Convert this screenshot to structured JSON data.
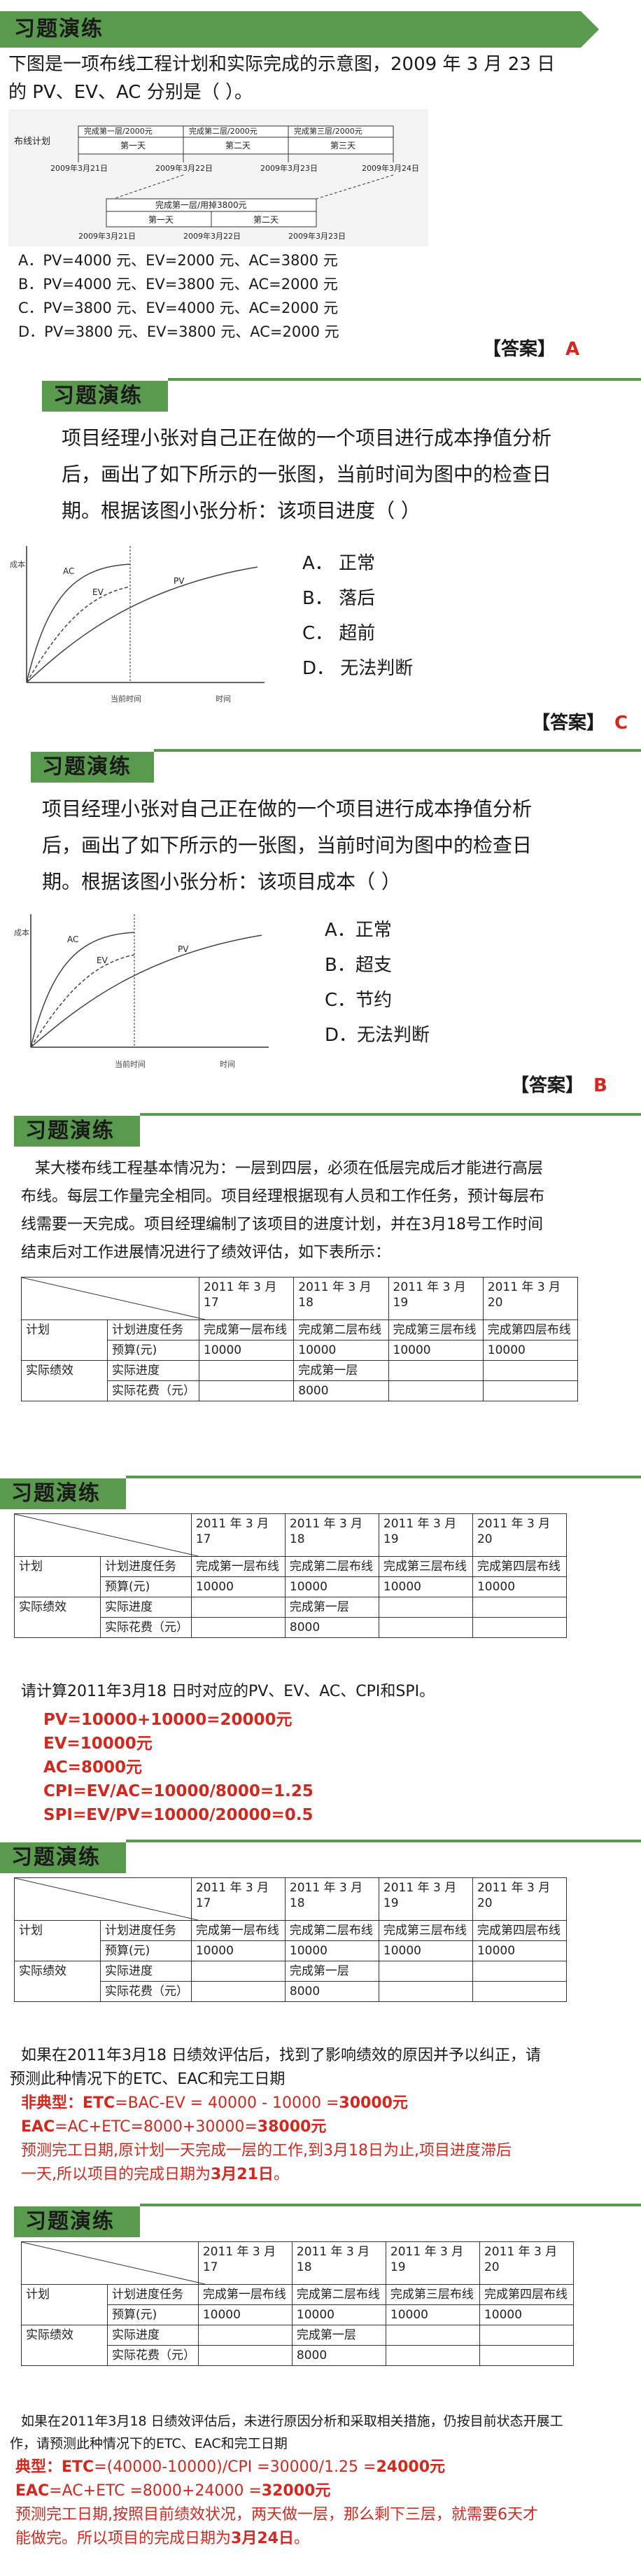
{
  "slide1": {
    "title": "习题演练",
    "question_line1": "下图是一项布线工程计划和实际完成的示意图，2009 年 3 月 23 日",
    "question_line2": "的 PV、EV、AC 分别是（    ）。",
    "diagram": {
      "row_label": "布线计划",
      "plan_cells": [
        "完成第一层/2000元",
        "完成第二层/2000元",
        "完成第三层/2000元"
      ],
      "plan_days": [
        "第一天",
        "第二天",
        "第三天"
      ],
      "plan_dates": [
        "2009年3月21日",
        "2009年3月22日",
        "2009年3月23日",
        "2009年3月24日"
      ],
      "actual_cell": "完成第一层/用掉3800元",
      "actual_days": [
        "第一天",
        "第二天"
      ],
      "actual_dates": [
        "2009年3月21日",
        "2009年3月22日",
        "2009年3月23日"
      ]
    },
    "options": [
      "A．PV=4000 元、EV=2000 元、AC=3800 元",
      "B．PV=4000 元、EV=3800 元、AC=2000 元",
      "C．PV=3800 元、EV=4000 元、AC=2000 元",
      "D．PV=3800 元、EV=3800 元、AC=2000 元"
    ],
    "answer_label": "【答案】",
    "answer_letter": "A"
  },
  "slide2": {
    "title": "习题演练",
    "question_line1": "项目经理小张对自己正在做的一个项目进行成本挣值分析",
    "question_line2": "后，画出了如下所示的一张图，当前时间为图中的检查日",
    "question_line3": "期。根据该图小张分析：该项目进度（   ）",
    "chart": {
      "ylabel": "成本",
      "xlabel": "时间",
      "check_label": "当前时间",
      "series": [
        "AC",
        "EV",
        "PV"
      ]
    },
    "options": [
      "A． 正常",
      "B． 落后",
      "C． 超前",
      "D． 无法判断"
    ],
    "answer_label": "【答案】",
    "answer_letter": "C"
  },
  "slide3": {
    "title": "习题演练",
    "question_line1": "项目经理小张对自己正在做的一个项目进行成本挣值分析",
    "question_line2": "后，画出了如下所示的一张图，当前时间为图中的检查日",
    "question_line3": "期。根据该图小张分析：该项目成本（   ）",
    "chart": {
      "ylabel": "成本",
      "xlabel": "时间",
      "check_label": "当前时间",
      "series": [
        "AC",
        "EV",
        "PV"
      ]
    },
    "options": [
      "A．正常",
      "B．超支",
      "C．节约",
      "D．无法判断"
    ],
    "answer_label": "【答案】",
    "answer_letter": "B"
  },
  "slide4": {
    "title": "习题演练",
    "para_line1": "某大楼布线工程基本情况为：一层到四层，必须在低层完成后才能进行高层",
    "para_line2": "布线。每层工作量完全相同。项目经理根据现有人员和工作任务，预计每层布",
    "para_line3": "线需要一天完成。项目经理编制了该项目的进度计划，并在3月18号工作时间",
    "para_line4": "结束后对工作进展情况进行了绩效评估，如下表所示："
  },
  "table": {
    "date_headers": [
      "2011 年 3 月 17",
      "2011 年 3 月 18",
      "2011 年 3 月 19",
      "2011 年 3 月 20"
    ],
    "group_plan": "计划",
    "group_actual": "实际绩效",
    "row_plan_task": "计划进度任务",
    "row_budget": "预算(元)",
    "row_actual_progress": "实际进度",
    "row_actual_cost": "实际花费（元）",
    "plan_tasks": [
      "完成第一层布线",
      "完成第二层布线",
      "完成第三层布线",
      "完成第四层布线"
    ],
    "budgets": [
      "10000",
      "10000",
      "10000",
      "10000"
    ],
    "actual_progress": [
      "",
      "完成第一层",
      "",
      ""
    ],
    "actual_cost": [
      "",
      "8000",
      "",
      ""
    ]
  },
  "slide5": {
    "title": "习题演练",
    "question": "请计算2011年3月18 日时对应的PV、EV、AC、CPI和SPI。",
    "answers": [
      "PV=10000+10000=20000元",
      "EV=10000元",
      "AC=8000元",
      "CPI=EV/AC=10000/8000=1.25",
      "SPI=EV/PV=10000/20000=0.5"
    ]
  },
  "slide6": {
    "title": "习题演练",
    "question_line1": "如果在2011年3月18 日绩效评估后，找到了影响绩效的原因并予以纠正，请",
    "question_line2": "预测此种情况下的ETC、EAC和完工日期",
    "atypical_label": "非典型",
    "etc_prefix": "：ETC",
    "etc_mid": "=BAC-EV = 40000 - 10000 =",
    "etc_result": "30000元",
    "eac_prefix": "EAC",
    "eac_mid": "=AC+ETC=8000+30000=",
    "eac_result": "38000元",
    "conclusion_line1": "预测完工日期,原计划一天完成一层的工作,到3月18日为止,项目进度滞后",
    "conclusion_line2_a": "一天,所以项目的完成日期为",
    "conclusion_line2_b": "3月21日",
    "conclusion_line2_c": "。"
  },
  "slide7": {
    "title": "习题演练",
    "question_line1": "如果在2011年3月18 日绩效评估后，未进行原因分析和采取相关措施，仍按目前状态开展工",
    "question_line2": "作，请预测此种情况下的ETC、EAC和完工日期",
    "typical_label": "典型",
    "etc_prefix": "：ETC",
    "etc_mid": "=(40000-10000)/CPI =30000/1.25 =",
    "etc_result": "24000元",
    "eac_prefix": "EAC",
    "eac_mid": "=AC+ETC =8000+24000 =",
    "eac_result": "32000元",
    "conclusion_line1": "预测完工日期,按照目前绩效状况，两天做一层，那么剩下三层，就需要6天才",
    "conclusion_line2_a": "能做完。所以项目的完成日期为",
    "conclusion_line2_b": "3月24日",
    "conclusion_line2_c": "。"
  }
}
